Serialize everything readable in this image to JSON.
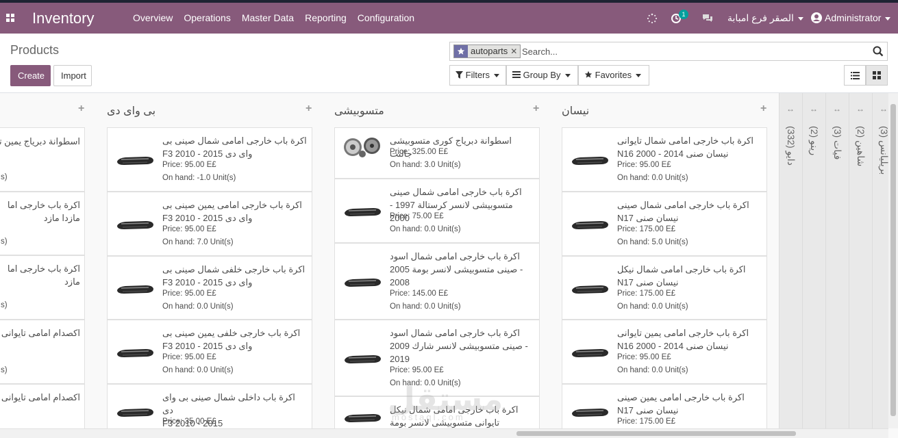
{
  "navbar": {
    "brand": "Inventory",
    "menu": [
      "Overview",
      "Operations",
      "Master Data",
      "Reporting",
      "Configuration"
    ],
    "activity_count": "1",
    "company": "الصقر فرع امبابة",
    "user": "Administrator"
  },
  "control_panel": {
    "title": "Products",
    "create_label": "Create",
    "import_label": "Import",
    "facet_value": "autoparts",
    "search_placeholder": "Search...",
    "filters_label": "Filters",
    "groupby_label": "Group By",
    "favorites_label": "Favorites"
  },
  "columns": [
    {
      "title": "",
      "cards": [
        {
          "name": "اسطوانة دبرياج يمين تا",
          "meta1": "s)",
          "meta2": ""
        },
        {
          "name": "اكرة باب خارجى اما\nمازدا مازد",
          "meta1": "s)",
          "meta2": ""
        },
        {
          "name": "اكرة باب خارجى اما\nمازد",
          "meta1": "s)",
          "meta2": ""
        },
        {
          "name": "اكصدام امامى تايوانى",
          "meta1": "s)",
          "meta2": ""
        },
        {
          "name": "اكصدام امامى تايوانى",
          "meta1": "",
          "meta2": ""
        }
      ]
    },
    {
      "title": "بى واى دى",
      "cards": [
        {
          "name": "اكرة باب خارجى امامى شمال صينى بى\nF3 2010 - 2015 واى دى",
          "price": "Price: 95.00 E£",
          "onhand": "On hand: -1.0 Unit(s)"
        },
        {
          "name": "اكرة باب خارجى امامى يمين صينى بى\nF3 2010 - 2015 واى دى",
          "price": "Price: 95.00 E£",
          "onhand": "On hand: 7.0 Unit(s)"
        },
        {
          "name": "اكرة باب خارجى خلفى شمال صينى بى\nF3 2010 - 2015 واى دى",
          "price": "Price: 95.00 E£",
          "onhand": "On hand: 0.0 Unit(s)"
        },
        {
          "name": "اكرة باب خارجى خلفى يمين صينى بى\nF3 2010 - 2015 واى دى",
          "price": "Price: 95.00 E£",
          "onhand": "On hand: 0.0 Unit(s)"
        },
        {
          "name": "اكرة باب داخلى شمال صينى بى واى دى\nF3 2010 - 2015",
          "price": "Price: 35.00 E£",
          "onhand": ""
        }
      ]
    },
    {
      "title": "متسوبيشى",
      "cards": [
        {
          "name": "اسطوانة دبرياج كورى متسوبيشى جالنت",
          "price": "Price: 325.00 E£",
          "onhand": "On hand: 3.0 Unit(s)"
        },
        {
          "name": "اكرة باب خارجى امامى شمال صينى\nمتسوبيشى لانسر كرستالة 1997 - 2000",
          "price": "Price: 75.00 E£",
          "onhand": "On hand: 0.0 Unit(s)"
        },
        {
          "name": "اكرة باب خارجى امامى شمال اسود\nصينى متسوبيشى لانسر بومة 2005 -\n2008",
          "price": "Price: 145.00 E£",
          "onhand": "On hand: 0.0 Unit(s)"
        },
        {
          "name": "اكرة باب خارجى امامى شمال اسود\nصينى متسوبيشى لانسر شارك 2009 -\n2019",
          "price": "Price: 95.00 E£",
          "onhand": "On hand: 0.0 Unit(s)"
        },
        {
          "name": "اكرة باب خارجى امامى شمال نيكل\nتايوانى متسوبيشى لانسر بومة",
          "price": "",
          "onhand": ""
        }
      ]
    },
    {
      "title": "نيسان",
      "cards": [
        {
          "name": "اكرة باب خارجى امامى شمال تايوانى\nN16 2000 - 2014 نيسان صنى",
          "price": "Price: 95.00 E£",
          "onhand": "On hand: 0.0 Unit(s)"
        },
        {
          "name": "اكرة باب خارجى امامى شمال صينى\nN17 نيسان صنى",
          "price": "Price: 175.00 E£",
          "onhand": "On hand: 5.0 Unit(s)"
        },
        {
          "name": "اكرة باب خارجى امامى شمال نيكل\nN17 نيسان صنى",
          "price": "Price: 175.00 E£",
          "onhand": "On hand: 0.0 Unit(s)"
        },
        {
          "name": "اكرة باب خارجى امامى يمين تايوانى\nN16 2000 - 2014 نيسان صنى",
          "price": "Price: 95.00 E£",
          "onhand": "On hand: 0.0 Unit(s)"
        },
        {
          "name": "اكرة باب خارجى امامى يمين صينى\nN17 نيسان صنى",
          "price": "Price: 175.00 E£",
          "onhand": ""
        }
      ]
    }
  ],
  "folded_columns": [
    "دايو (332)",
    "رينو (2)",
    "فيات (3)",
    "شاهين (2)",
    "بريليانس (3)"
  ],
  "watermark": "مستقل",
  "watermark_sub": "mostaql.com"
}
